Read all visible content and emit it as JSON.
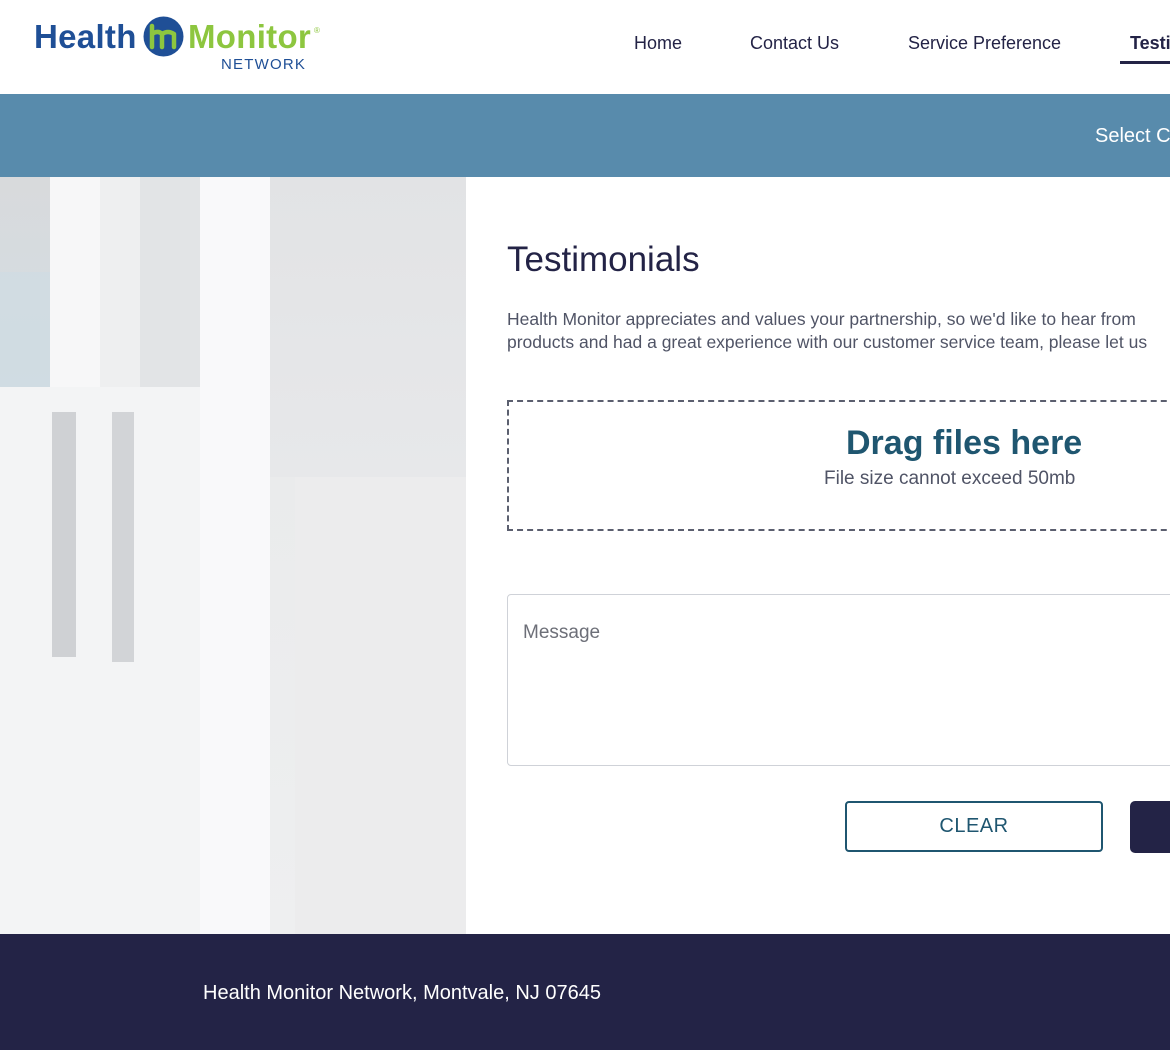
{
  "brand": {
    "name_part1": "Health",
    "name_part2": "Monitor",
    "sub": "NETWORK",
    "mark_letters": "hm",
    "colors": {
      "blue": "#1f4f96",
      "green": "#8dc63f"
    }
  },
  "nav": {
    "items": [
      {
        "label": "Home"
      },
      {
        "label": "Contact Us"
      },
      {
        "label": "Service Preference"
      },
      {
        "label": "Testi"
      }
    ],
    "active_index": 3
  },
  "banner": {
    "select_label": "Select C",
    "color": "#588bac"
  },
  "main": {
    "title": "Testimonials",
    "intro_lines": [
      "Health Monitor appreciates and values your partnership, so we'd like to hear from",
      "products and had a great experience with our customer service team, please let us"
    ],
    "dropzone": {
      "title": "Drag files here",
      "subtitle": "File size cannot exceed 50mb"
    },
    "message": {
      "placeholder": "Message"
    },
    "buttons": {
      "clear": "CLEAR"
    }
  },
  "footer": {
    "address": "Health Monitor Network, Montvale, NJ 07645",
    "color": "#232346"
  }
}
